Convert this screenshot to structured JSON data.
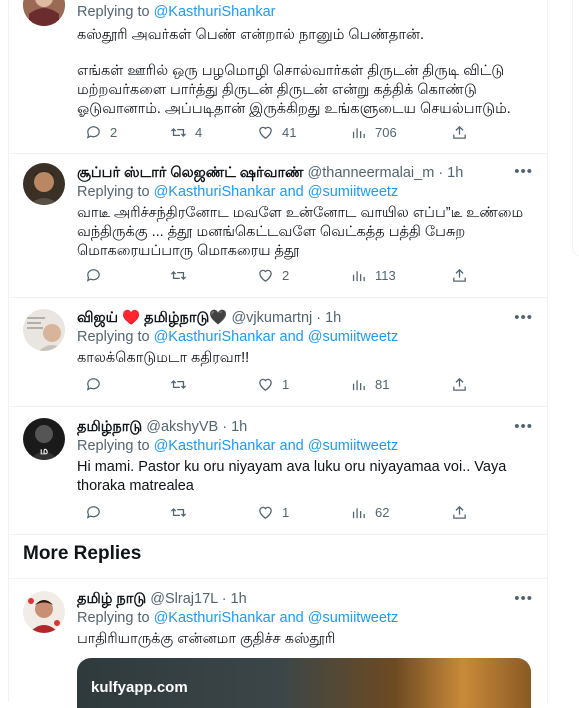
{
  "tweets": [
    {
      "reply_prefix": "Replying to ",
      "reply_to": "@KasthuriShankar",
      "text1": "கஸ்தூரி அவர்கள் பெண் என்றால் நானும் பெண்தான்.",
      "text2": "எங்கள் ஊரில் ஒரு பழமொழி சொல்வார்கள் திருடன் திருடி விட்டு மற்றவர்களை பார்த்து திருடன் திருடன் என்று கத்திக் கொண்டு ஓடுவானாம். அப்படிதான் இருக்கிறது உங்களுடைய செயல்பாடும்.",
      "replies": "2",
      "retweets": "4",
      "likes": "41",
      "views": "706"
    },
    {
      "name": "சூப்பர் ஸ்டார் லெஜண்ட் ஷர்வாண்",
      "handle": "@thanneermalai_m",
      "time": "· 1h",
      "reply_prefix": "Replying to ",
      "reply_to": "@KasthuriShankar and @sumiitweetz",
      "text": "வாடீ அரிச்சந்திரனோட மவளே உன்னோட வாயில எப்ப”டீ உண்மை வந்திருக்கு ... த்தூ மனங்கெட்டவளே வெட்கத்த பத்தி பேசுற மொகரையப்பாரு மொகரைய த்தூ",
      "replies": "",
      "retweets": "",
      "likes": "2",
      "views": "113"
    },
    {
      "name": "விஜய் ♥️ தமிழ்நாடு🖤",
      "handle": "@vjkumartnj",
      "time": "· 1h",
      "reply_prefix": "Replying to ",
      "reply_to": "@KasthuriShankar and @sumiitweetz",
      "text": "காலக்கொடுமடா கதிரவா!!",
      "replies": "",
      "retweets": "",
      "likes": "1",
      "views": "81"
    },
    {
      "name": "தமிழ்நாடு",
      "handle": "@akshyVB",
      "time": "· 1h",
      "reply_prefix": "Replying to ",
      "reply_to": "@KasthuriShankar and @sumiitweetz",
      "text": "Hi mami. Pastor ku oru niyayam ava luku oru niyayamaa voi.. Vaya thoraka matrealea",
      "replies": "",
      "retweets": "",
      "likes": "1",
      "views": "62"
    },
    {
      "name": "தமிழ் நாடு",
      "handle": "@Slraj17L",
      "time": "· 1h",
      "reply_prefix": "Replying to ",
      "reply_to": "@KasthuriShankar and @sumiitweetz",
      "text": "பாதிரியாருக்கு என்னமா குதிச்ச கஸ்தூரி",
      "media_watermark": "kulfyapp.com"
    }
  ],
  "section_title": "More Replies",
  "colors": {
    "link": "#1d9bf0",
    "muted": "#536471",
    "border": "#eff3f4"
  }
}
